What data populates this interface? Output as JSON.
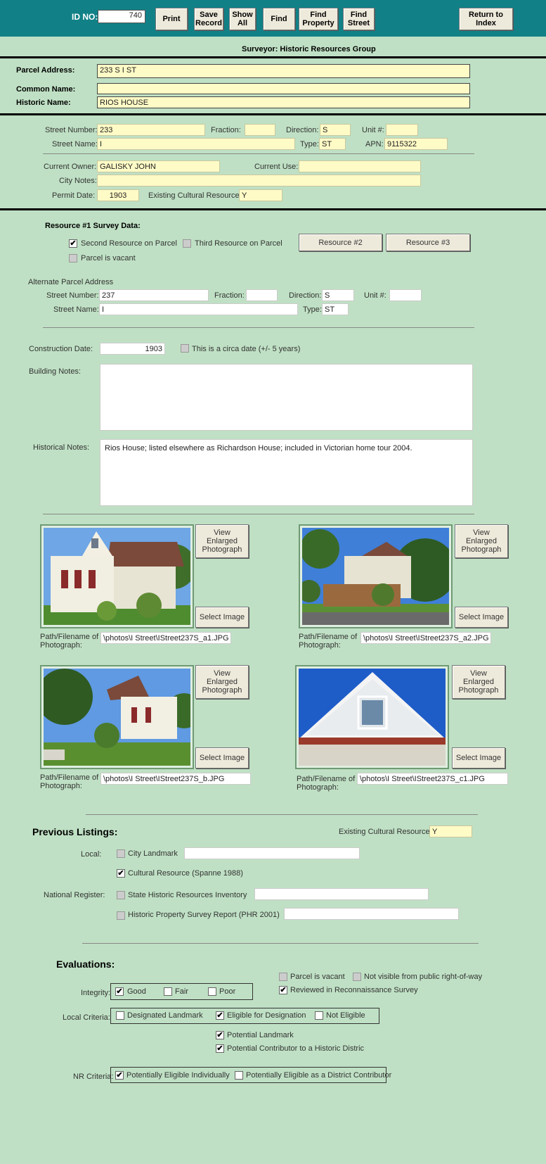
{
  "toolbar": {
    "id_label": "ID NO:",
    "id_value": "740",
    "print": "Print",
    "save": "Save\nRecord",
    "show_all": "Show\nAll",
    "find": "Find",
    "find_property": "Find\nProperty",
    "find_street": "Find\nStreet",
    "return": "Return to\nIndex"
  },
  "surveyor": "Surveyor:  Historic Resources Group",
  "parcel": {
    "address_label": "Parcel Address:",
    "address": "233 S I ST",
    "common_label": "Common Name:",
    "common": "",
    "historic_label": "Historic Name:",
    "historic": "RIOS HOUSE"
  },
  "street": {
    "number_label": "Street Number:",
    "number": "233",
    "fraction_label": "Fraction:",
    "fraction": "",
    "direction_label": "Direction:",
    "direction": "S",
    "unit_label": "Unit #:",
    "unit": "",
    "name_label": "Street Name:",
    "name": "I",
    "type_label": "Type:",
    "type": "ST",
    "apn_label": "APN:",
    "apn": "9115322"
  },
  "owner": {
    "owner_label": "Current Owner:",
    "owner": "GALISKY  JOHN",
    "use_label": "Current Use:",
    "use": "",
    "notes_label": "City Notes:",
    "notes": "",
    "permit_label": "Permit Date:",
    "permit": "1903",
    "ecr_label": "Existing Cultural Resource:",
    "ecr": "Y"
  },
  "resource": {
    "title": "Resource #1 Survey Data:",
    "second": "Second Resource on Parcel",
    "third": "Third Resource on Parcel",
    "vacant": "Parcel is vacant",
    "btn2": "Resource #2",
    "btn3": "Resource #3",
    "alt_title": "Alternate Parcel Address",
    "alt_number_label": "Street Number:",
    "alt_number": "237",
    "alt_fraction_label": "Fraction:",
    "alt_fraction": "",
    "alt_direction_label": "Direction:",
    "alt_direction": "S",
    "alt_unit_label": "Unit #:",
    "alt_unit": "",
    "alt_name_label": "Street Name:",
    "alt_name": "I",
    "alt_type_label": "Type:",
    "alt_type": "ST",
    "construction_label": "Construction Date:",
    "construction": "1903",
    "circa": "This is a circa date (+/- 5 years)",
    "building_label": "Building Notes:",
    "building": "",
    "historical_label": "Historical Notes:",
    "historical": "Rios House; listed elsewhere as Richardson House; included in Victorian home tour 2004."
  },
  "photos": {
    "view": "View\nEnlarged\nPhotograph",
    "select": "Select Image",
    "path_label": "Path/Filename of\nPhotograph:",
    "p1": "\\photos\\I Street\\IStreet237S_a1.JPG",
    "p2": "\\photos\\I Street\\IStreet237S_a2.JPG",
    "p3": "\\photos\\I Street\\IStreet237S_b.JPG",
    "p4": "\\photos\\I Street\\IStreet237S_c1.JPG"
  },
  "listings": {
    "title": "Previous Listings:",
    "ecr_label": "Existing Cultural Resource:",
    "ecr": "Y",
    "local_label": "Local:",
    "city_landmark": "City Landmark",
    "cultural_resource": "Cultural Resource (Spanne 1988)",
    "national_label": "National Register:",
    "state_inventory": "State Historic Resources Inventory",
    "phr": "Historic Property Survey Report (PHR 2001)"
  },
  "evaluations": {
    "title": "Evaluations:",
    "vacant": "Parcel is vacant",
    "not_visible": "Not visible from public right-of-way",
    "reviewed": "Reviewed in Reconnaissance Survey",
    "integrity_label": "Integrity:",
    "good": "Good",
    "fair": "Fair",
    "poor": "Poor",
    "local_label": "Local Criteria:",
    "designated": "Designated Landmark",
    "eligible": "Eligible for Designation",
    "not_eligible": "Not Eligible",
    "potential_landmark": "Potential Landmark",
    "potential_contributor": "Potential Contributor to a Historic Distric",
    "nr_label": "NR Criteria:",
    "individually": "Potentially Eligible Individually",
    "district": "Potentially Eligible as a District Contributor"
  },
  "colors": {
    "toolbar": "#118187",
    "background": "#bfe0c4",
    "field": "#fffbc6"
  }
}
